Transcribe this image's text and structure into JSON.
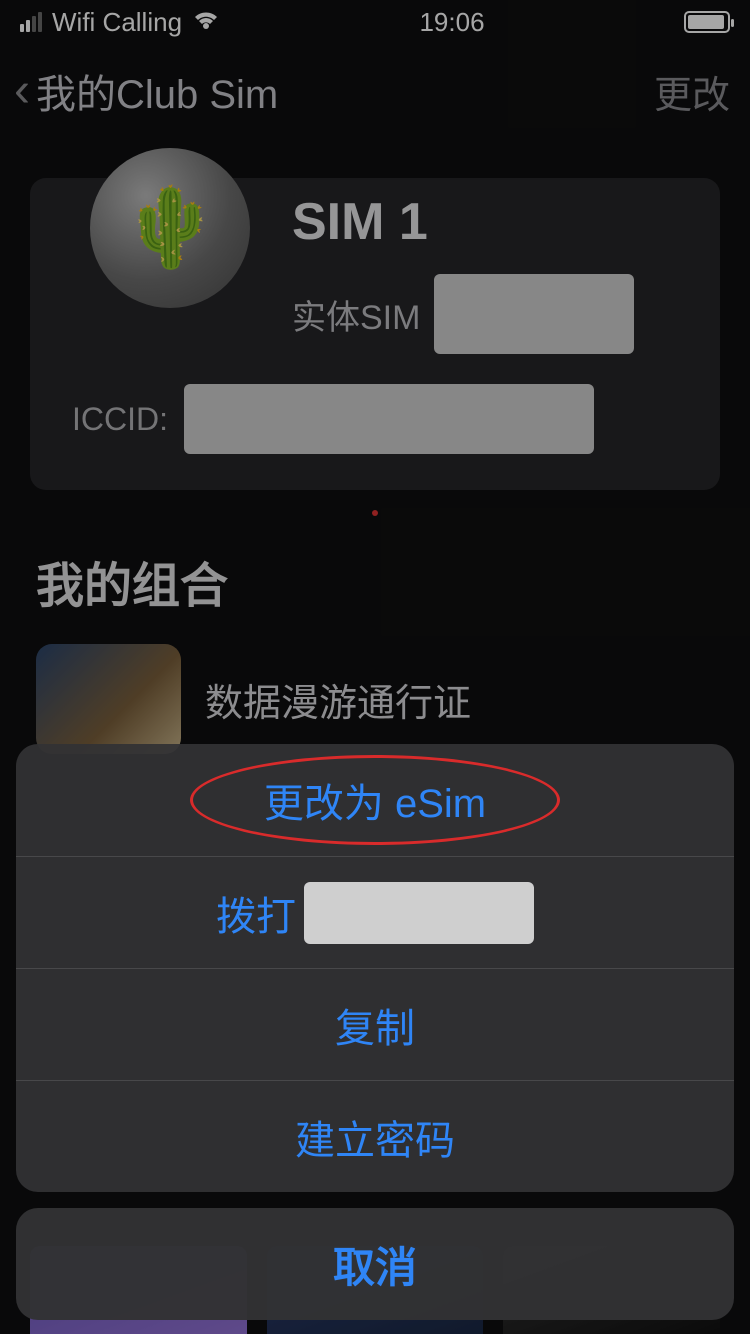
{
  "statusbar": {
    "carrier": "Wifi Calling",
    "time": "19:06"
  },
  "nav": {
    "title": "我的Club Sim",
    "action": "更改"
  },
  "sim": {
    "avatar_emoji": "🌵",
    "name": "SIM 1",
    "type_label": "实体SIM",
    "iccid_label": "ICCID:"
  },
  "section": {
    "my_combo": "我的组合"
  },
  "combo": {
    "item1_title": "数据漫游通行证"
  },
  "sheet": {
    "change_esim": "更改为 eSim",
    "dial_prefix": "拨打",
    "copy": "复制",
    "create_password": "建立密码",
    "cancel": "取消"
  }
}
